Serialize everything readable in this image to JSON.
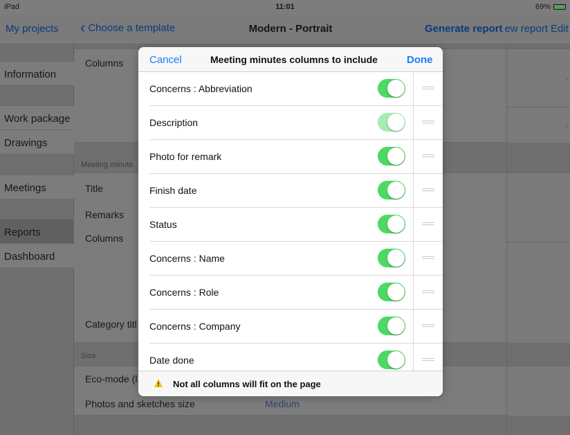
{
  "status_bar": {
    "device": "iPad",
    "time": "11:01",
    "battery": "69%"
  },
  "nav": {
    "my_projects": "My projects",
    "back_label": "Choose a template",
    "title": "Modern - Portrait",
    "generate_report": "Generate report",
    "new_report": "ew report",
    "edit": "Edit"
  },
  "sidebar": {
    "items": [
      {
        "label": "Information"
      },
      {
        "label": "Work package"
      },
      {
        "label": "Drawings"
      },
      {
        "label": "Meetings"
      },
      {
        "label": "Reports"
      },
      {
        "label": "Dashboard"
      }
    ]
  },
  "content": {
    "columns_top": "Columns",
    "section_meeting": "Meeting minute",
    "title_label": "Title",
    "remarks_label": "Remarks",
    "columns_label": "Columns",
    "category_title": "Category titl",
    "section_size": "Size",
    "eco_mode": "Eco-mode (l",
    "photos_size_label": "Photos and sketches size",
    "photos_size_value": "Medium"
  },
  "modal": {
    "cancel": "Cancel",
    "title": "Meeting minutes columns to include",
    "done": "Done",
    "rows": [
      {
        "label": "Concerns : Abbreviation",
        "enabled": true,
        "locked": false
      },
      {
        "label": "Description",
        "enabled": true,
        "locked": true
      },
      {
        "label": "Photo for remark",
        "enabled": true,
        "locked": false
      },
      {
        "label": "Finish date",
        "enabled": true,
        "locked": false
      },
      {
        "label": "Status",
        "enabled": true,
        "locked": false
      },
      {
        "label": "Concerns : Name",
        "enabled": true,
        "locked": false
      },
      {
        "label": "Concerns : Role",
        "enabled": true,
        "locked": false
      },
      {
        "label": "Concerns : Company",
        "enabled": true,
        "locked": false
      },
      {
        "label": "Date done",
        "enabled": true,
        "locked": false
      }
    ],
    "warning": "Not all columns will fit on the page"
  },
  "colors": {
    "accent": "#1a7cf5",
    "toggle_on": "#4cd964",
    "warning": "#f5c400"
  }
}
